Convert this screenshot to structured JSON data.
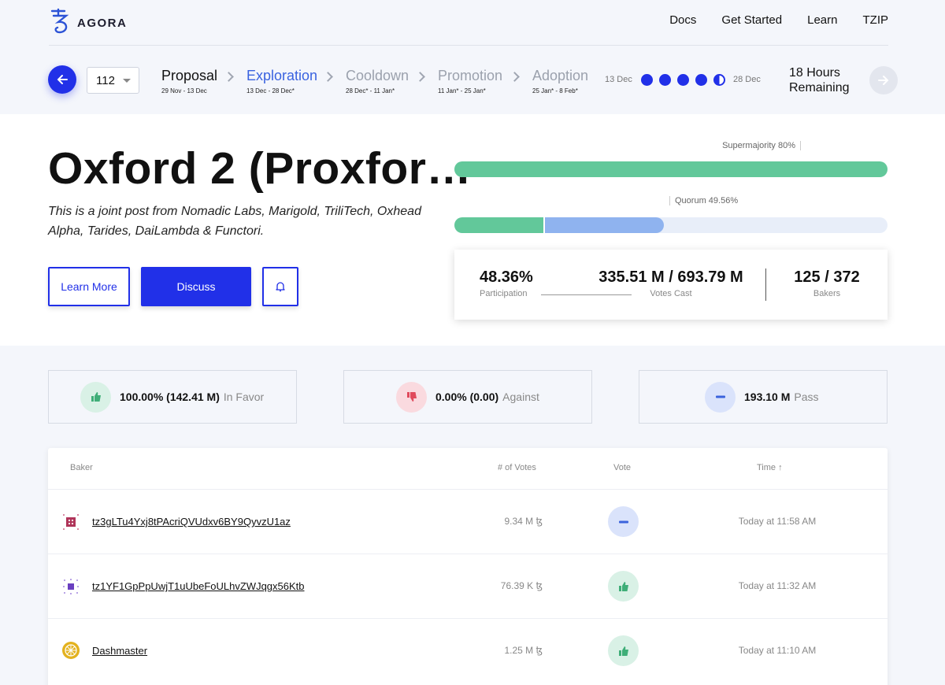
{
  "brand": {
    "name": "AGORA",
    "accent": "#2130e8"
  },
  "nav": [
    "Docs",
    "Get Started",
    "Learn",
    "TZIP"
  ],
  "period": {
    "selected": "112"
  },
  "stages": [
    {
      "name": "Proposal",
      "dates": "29 Nov - 13 Dec",
      "state": "done"
    },
    {
      "name": "Exploration",
      "dates": "13 Dec - 28 Dec*",
      "state": "active"
    },
    {
      "name": "Cooldown",
      "dates": "28 Dec* - 11 Jan*",
      "state": "future"
    },
    {
      "name": "Promotion",
      "dates": "11 Jan* - 25 Jan*",
      "state": "future"
    },
    {
      "name": "Adoption",
      "dates": "25 Jan* - 8 Feb*",
      "state": "future"
    }
  ],
  "progress": {
    "start": "13 Dec",
    "end": "28 Dec",
    "remaining_line1": "18 Hours",
    "remaining_line2": "Remaining"
  },
  "proposal": {
    "title": "Oxford 2 (Proxfor…",
    "subtitle": "This is a joint post from Nomadic Labs, Marigold, TriliTech, Oxhead Alpha, Tarides, DaiLambda & Functori.",
    "learn_more": "Learn More",
    "discuss": "Discuss"
  },
  "bars": {
    "supermajority_label": "Supermajority 80%",
    "supermajority_fill": 1.0,
    "quorum_label": "Quorum 49.56%",
    "quorum_yay_fraction": 0.205,
    "quorum_pass_fraction": 0.2785,
    "colors": {
      "yay": "#62c89a",
      "pass": "#8fb3ef",
      "track": "#e8eef9"
    }
  },
  "stats": {
    "participation": {
      "value": "48.36%",
      "label": "Participation"
    },
    "votes_cast": {
      "value": "335.51 M / 693.79 M",
      "label": "Votes Cast"
    },
    "bakers": {
      "value": "125 / 372",
      "label": "Bakers"
    }
  },
  "summary": {
    "favor": {
      "value": "100.00% (142.41 M)",
      "label": "In Favor"
    },
    "against": {
      "value": "0.00% (0.00)",
      "label": "Against"
    },
    "pass": {
      "value": "193.10 M",
      "label": "Pass"
    }
  },
  "table": {
    "headers": {
      "baker": "Baker",
      "votes": "# of Votes",
      "vote": "Vote",
      "time": "Time ↑"
    },
    "rows": [
      {
        "baker": "tz3gLTu4Yxj8tPAcriQVUdxv6BY9QyvzU1az",
        "votes": "9.34 M ꜩ",
        "vote": "pass",
        "time": "Today at 11:58 AM"
      },
      {
        "baker": "tz1YF1GpPpUwjT1uUbeFoULhvZWJqgx56Ktb",
        "votes": "76.39 K ꜩ",
        "vote": "yay",
        "time": "Today at 11:32 AM"
      },
      {
        "baker": "Dashmaster",
        "votes": "1.25 M ꜩ",
        "vote": "yay",
        "time": "Today at 11:10 AM"
      }
    ]
  }
}
